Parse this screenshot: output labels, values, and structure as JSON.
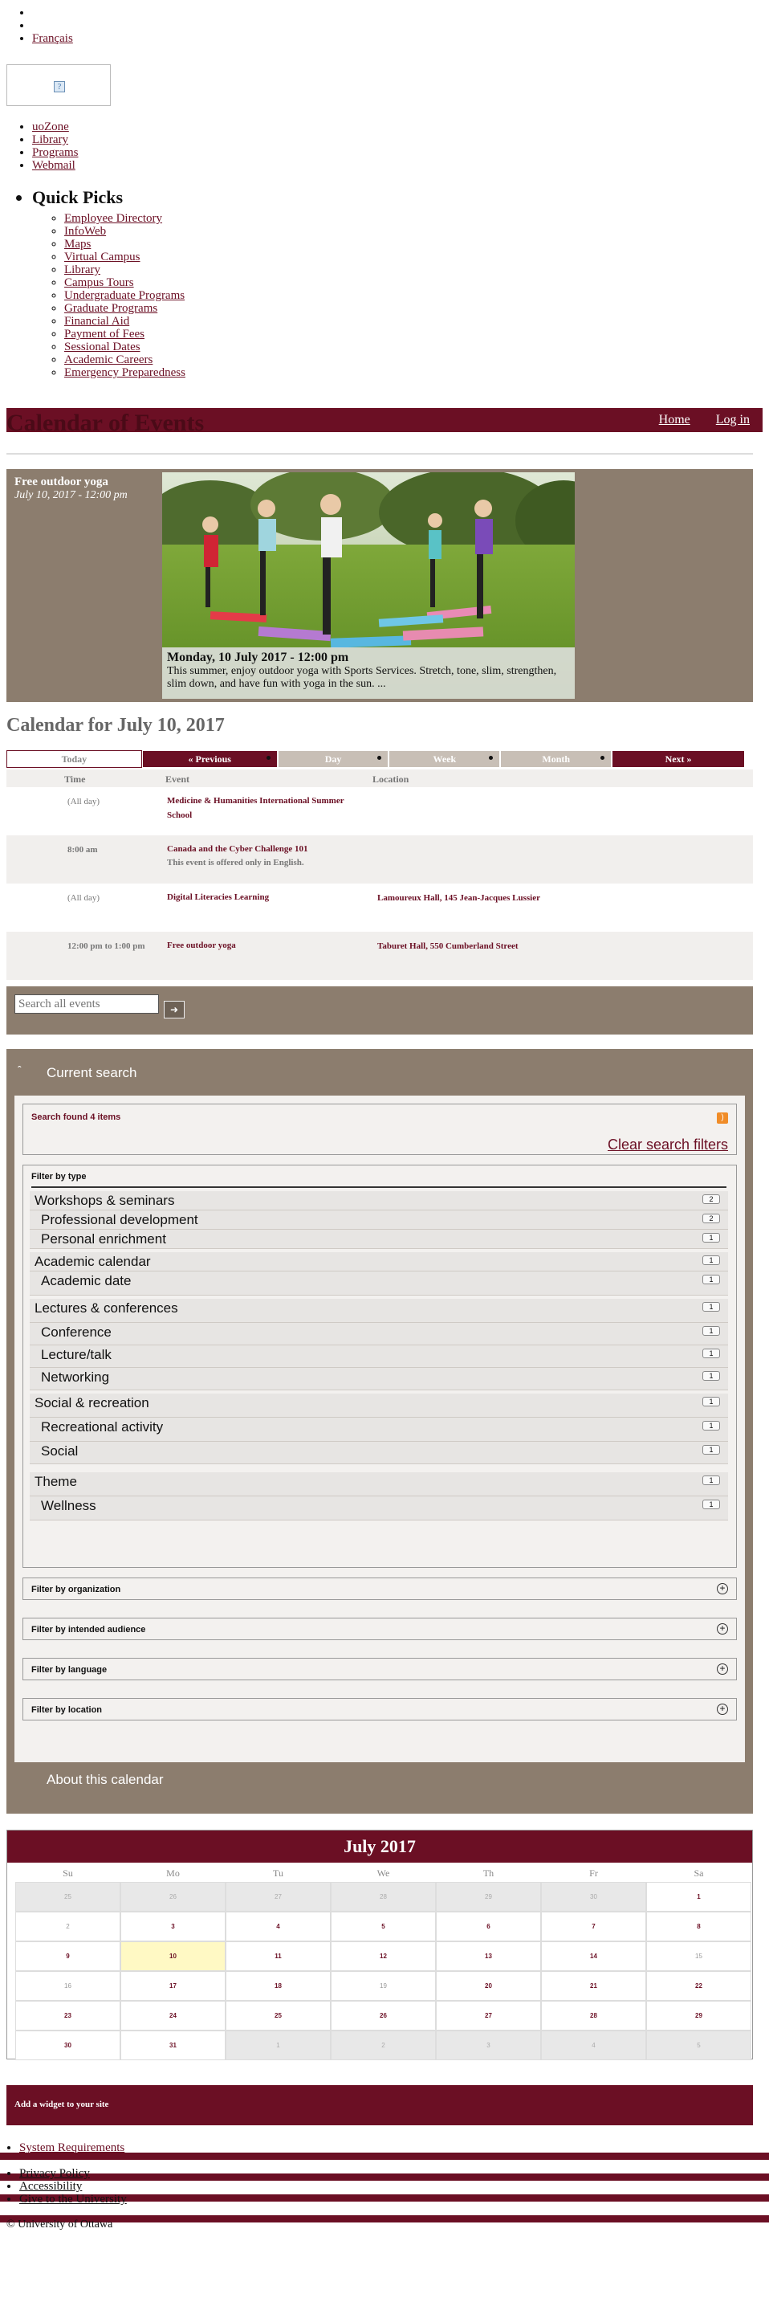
{
  "top": {
    "bullets": [
      "",
      ""
    ],
    "language_link": "Français",
    "broken_image_glyph": "?"
  },
  "main_nav": [
    "uoZone",
    "Library",
    "Programs",
    "Webmail"
  ],
  "quick_picks": {
    "title": "Quick Picks",
    "items": [
      "Employee Directory",
      "InfoWeb",
      "Maps",
      "Virtual Campus",
      "Library",
      "Campus Tours",
      "Undergraduate Programs",
      "Graduate Programs",
      "Financial Aid",
      "Payment of Fees",
      "Sessional Dates",
      "Academic Careers",
      "Emergency Preparedness"
    ]
  },
  "header": {
    "title": "Calendar of Events",
    "home": "Home",
    "login": "Log in"
  },
  "featured": {
    "title": "Free outdoor yoga",
    "datetime": "July 10, 2017 - 12:00 pm",
    "caption_date": "Monday, 10 July 2017 - 12:00 pm",
    "caption_text": "This summer, enjoy outdoor yoga with Sports Services. Stretch, tone, slim, strengthen, slim down, and have fun with yoga in the sun. ..."
  },
  "calendar": {
    "heading": "Calendar for July 10, 2017",
    "tabs": {
      "today": "Today",
      "previous": "« Previous",
      "day": "Day",
      "week": "Week",
      "month": "Month",
      "next": "Next »"
    },
    "columns": {
      "time": "Time",
      "event": "Event",
      "location": "Location"
    },
    "events": [
      {
        "time": "(All day)",
        "event": "Medicine & Humanities International Summer School",
        "note": "",
        "location": ""
      },
      {
        "time": "8:00 am",
        "event": "Canada and the Cyber Challenge 101",
        "note": "This event is offered only in English.",
        "location": ""
      },
      {
        "time": "(All day)",
        "event": "Digital Literacies Learning",
        "note": "",
        "location": "Lamoureux Hall, 145 Jean-Jacques Lussier"
      },
      {
        "time": "12:00 pm to 1:00 pm",
        "event": "Free outdoor yoga",
        "note": "",
        "location": "Taburet Hall, 550 Cumberland Street"
      }
    ]
  },
  "search": {
    "placeholder": "Search all events",
    "go_icon": "arrow-right-icon"
  },
  "current_search": {
    "title": "Current search",
    "found": "Search found 4 items",
    "clear": "Clear search filters",
    "filter_by_type": "Filter by type",
    "types": [
      {
        "name": "Workshops & seminars",
        "count": "2",
        "level": 0
      },
      {
        "name": "Professional development",
        "count": "2",
        "level": 1
      },
      {
        "name": "Personal enrichment",
        "count": "1",
        "level": 1
      },
      {
        "name": "Academic calendar",
        "count": "1",
        "level": 0
      },
      {
        "name": "Academic date",
        "count": "1",
        "level": 1
      },
      {
        "name": "Lectures & conferences",
        "count": "1",
        "level": 0
      },
      {
        "name": "Conference",
        "count": "1",
        "level": 1
      },
      {
        "name": "Lecture/talk",
        "count": "1",
        "level": 1
      },
      {
        "name": "Networking",
        "count": "1",
        "level": 1
      },
      {
        "name": "Social & recreation",
        "count": "1",
        "level": 0
      },
      {
        "name": "Recreational activity",
        "count": "1",
        "level": 1
      },
      {
        "name": "Social",
        "count": "1",
        "level": 1
      },
      {
        "name": "Theme",
        "count": "1",
        "level": 0
      },
      {
        "name": "Wellness",
        "count": "1",
        "level": 1
      }
    ],
    "other_filters": [
      "Filter by organization",
      "Filter by intended audience",
      "Filter by language",
      "Filter by location"
    ],
    "about": "About this calendar"
  },
  "mini_calendar": {
    "title": "July 2017",
    "dow": [
      "Su",
      "Mo",
      "Tu",
      "We",
      "Th",
      "Fr",
      "Sa"
    ],
    "days": [
      [
        "25",
        "other"
      ],
      [
        "26",
        "other"
      ],
      [
        "27",
        "other"
      ],
      [
        "28",
        "other"
      ],
      [
        "29",
        "other"
      ],
      [
        "30",
        "other"
      ],
      [
        "1",
        "cur"
      ],
      [
        "2",
        "plain"
      ],
      [
        "3",
        "cur"
      ],
      [
        "4",
        "cur"
      ],
      [
        "5",
        "cur"
      ],
      [
        "6",
        "cur"
      ],
      [
        "7",
        "cur"
      ],
      [
        "8",
        "cur"
      ],
      [
        "9",
        "cur"
      ],
      [
        "10",
        "today"
      ],
      [
        "11",
        "cur"
      ],
      [
        "12",
        "cur"
      ],
      [
        "13",
        "cur"
      ],
      [
        "14",
        "cur"
      ],
      [
        "15",
        "plain"
      ],
      [
        "16",
        "plain"
      ],
      [
        "17",
        "cur"
      ],
      [
        "18",
        "cur"
      ],
      [
        "19",
        "plain"
      ],
      [
        "20",
        "cur"
      ],
      [
        "21",
        "cur"
      ],
      [
        "22",
        "cur"
      ],
      [
        "23",
        "cur"
      ],
      [
        "24",
        "cur"
      ],
      [
        "25",
        "cur"
      ],
      [
        "26",
        "cur"
      ],
      [
        "27",
        "cur"
      ],
      [
        "28",
        "cur"
      ],
      [
        "29",
        "cur"
      ],
      [
        "30",
        "cur"
      ],
      [
        "31",
        "cur"
      ],
      [
        "1",
        "other"
      ],
      [
        "2",
        "other"
      ],
      [
        "3",
        "other"
      ],
      [
        "4",
        "other"
      ],
      [
        "5",
        "other"
      ]
    ]
  },
  "widget": {
    "label": "Add a widget to your site"
  },
  "footer": {
    "links": [
      "System Requirements",
      "Privacy Policy",
      "Accessibility",
      "Give to the University"
    ],
    "copyright": "© University of Ottawa"
  },
  "colors": {
    "brand": "#6b0f24",
    "taupe": "#8c7d6e"
  }
}
